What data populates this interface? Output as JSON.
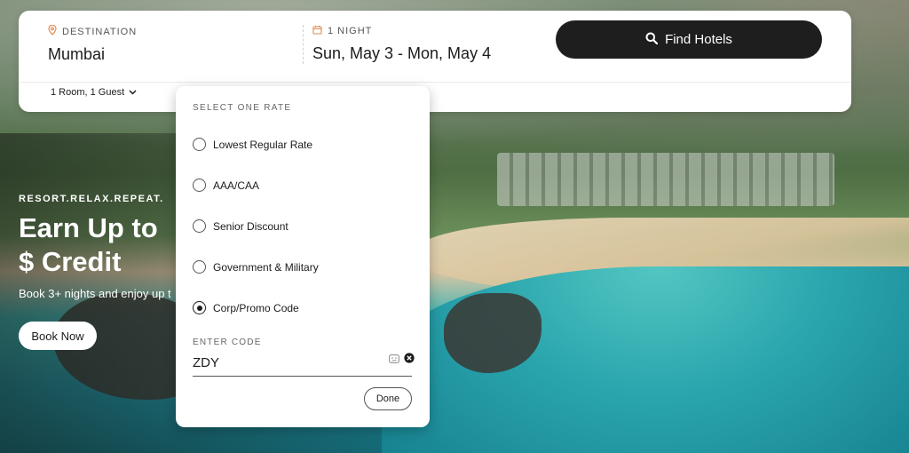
{
  "colors": {
    "primary_button": "#1e1e1e",
    "accent_orange": "#e08a4a",
    "card_bg": "#ffffff"
  },
  "search": {
    "destination_label": "DESTINATION",
    "destination_value": "Mumbai",
    "dates_label": "1 NIGHT",
    "dates_value": "Sun, May 3 - Mon, May 4",
    "find_button": "Find Hotels",
    "rooms_guests": "1 Room, 1 Guest"
  },
  "hero": {
    "tagline": "RESORT.RELAX.REPEAT.",
    "headline": "Earn Up to $ Credit",
    "subtext": "Book 3+ nights and enjoy up t",
    "book_button": "Book Now"
  },
  "rates": {
    "title": "SELECT ONE RATE",
    "options": [
      {
        "label": "Lowest Regular Rate",
        "selected": false
      },
      {
        "label": "AAA/CAA",
        "selected": false
      },
      {
        "label": "Senior Discount",
        "selected": false
      },
      {
        "label": "Government & Military",
        "selected": false
      },
      {
        "label": "Corp/Promo Code",
        "selected": true
      }
    ],
    "code_label": "ENTER CODE",
    "code_value": "ZDY",
    "done_button": "Done"
  },
  "icons": {
    "destination": "location-pin-icon",
    "dates": "calendar-icon",
    "search": "search-icon",
    "chevron": "chevron-down-icon",
    "keyboard": "keyboard-icon",
    "clear": "clear-icon"
  }
}
